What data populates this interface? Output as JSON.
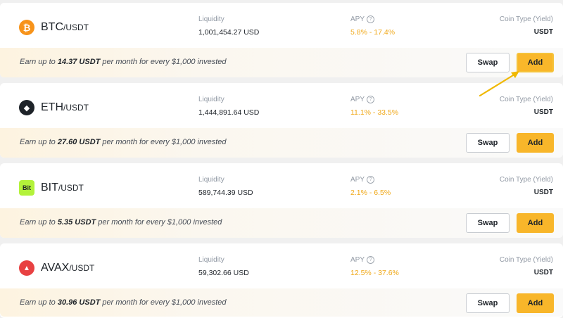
{
  "labels": {
    "liquidity": "Liquidity",
    "apy": "APY",
    "coin_type": "Coin Type (Yield)",
    "info_glyph": "?",
    "swap": "Swap",
    "add": "Add",
    "earn_prefix": "Earn up to ",
    "earn_suffix": " per month for every $1,000 invested"
  },
  "colors": {
    "accent": "#f8b62a",
    "apy_text": "#f0a818",
    "arrow": "#f0b800"
  },
  "pools": [
    {
      "icon": "bitcoin-icon",
      "icon_glyph": "₿",
      "icon_color": "#f7931a",
      "base": "BTC",
      "quote": "/USDT",
      "liquidity": "1,001,454.27 USD",
      "apy": "5.8% - 17.4%",
      "coin_type": "USDT",
      "earn_amount": "14.37 USDT"
    },
    {
      "icon": "ethereum-icon",
      "icon_glyph": "◆",
      "icon_color": "#1e2329",
      "base": "ETH",
      "quote": "/USDT",
      "liquidity": "1,444,891.64 USD",
      "apy": "11.1% - 33.5%",
      "coin_type": "USDT",
      "earn_amount": "27.60 USDT"
    },
    {
      "icon": "bit-icon",
      "icon_glyph": "Bit",
      "icon_color": "#b3f23a",
      "base": "BIT",
      "quote": "/USDT",
      "liquidity": "589,744.39 USD",
      "apy": "2.1% - 6.5%",
      "coin_type": "USDT",
      "earn_amount": "5.35 USDT"
    },
    {
      "icon": "avalanche-icon",
      "icon_glyph": "▲",
      "icon_color": "#e84142",
      "base": "AVAX",
      "quote": "/USDT",
      "liquidity": "59,302.66 USD",
      "apy": "12.5% - 37.6%",
      "coin_type": "USDT",
      "earn_amount": "30.96 USDT"
    }
  ]
}
